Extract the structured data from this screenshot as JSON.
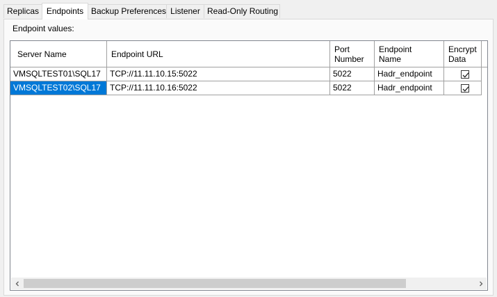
{
  "tabs": [
    {
      "label": "Replicas"
    },
    {
      "label": "Endpoints"
    },
    {
      "label": "Backup Preferences"
    },
    {
      "label": "Listener"
    },
    {
      "label": "Read-Only Routing"
    }
  ],
  "active_tab": "Endpoints",
  "panel": {
    "caption": "Endpoint values:"
  },
  "grid": {
    "columns": [
      {
        "label": "Server Name"
      },
      {
        "label": "Endpoint URL"
      },
      {
        "label": "Port\nNumber"
      },
      {
        "label": "Endpoint\nName"
      },
      {
        "label": "Encrypt\nData"
      }
    ],
    "rows": [
      {
        "server_name": "VMSQLTEST01\\SQL17",
        "endpoint_url": "TCP://11.11.10.15:5022",
        "port": "5022",
        "endpoint_name": "Hadr_endpoint",
        "encrypt": true,
        "selected": false
      },
      {
        "server_name": "VMSQLTEST02\\SQL17",
        "endpoint_url": "TCP://11.11.10.16:5022",
        "port": "5022",
        "endpoint_name": "Hadr_endpoint",
        "encrypt": true,
        "selected": true
      }
    ]
  },
  "icons": {
    "scroll_left": "chevron-left-icon",
    "scroll_right": "chevron-right-icon",
    "checkbox": "checkmark-icon"
  },
  "colors": {
    "selection": "#0078d7",
    "grid_border": "#828790"
  }
}
